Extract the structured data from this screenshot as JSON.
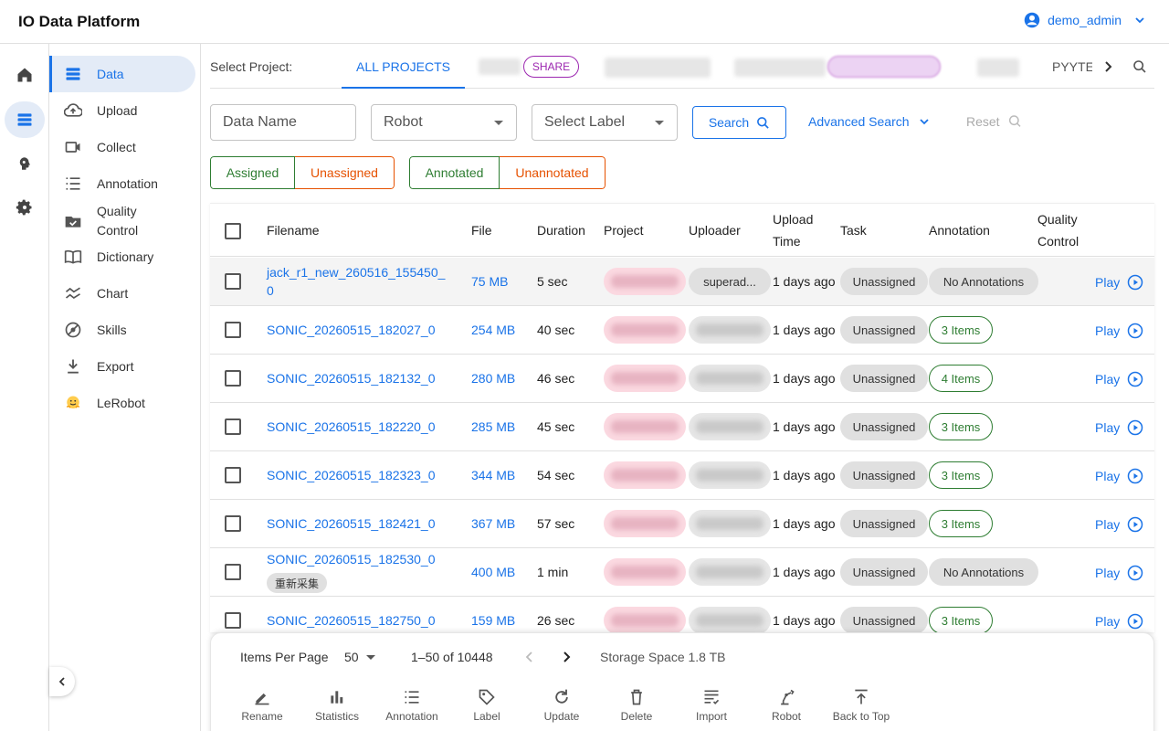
{
  "app": {
    "title": "IO Data Platform",
    "user": "demo_admin"
  },
  "rail": [
    {
      "name": "home-icon"
    },
    {
      "name": "data-icon"
    },
    {
      "name": "brain-icon"
    },
    {
      "name": "gear-icon"
    }
  ],
  "sidebar": {
    "items": [
      {
        "label": "Data",
        "icon": "list-icon"
      },
      {
        "label": "Upload",
        "icon": "cloud-upload-icon"
      },
      {
        "label": "Collect",
        "icon": "video-icon"
      },
      {
        "label": "Annotation",
        "icon": "checklist-icon"
      },
      {
        "label": "Quality Control",
        "icon": "folder-check-icon"
      },
      {
        "label": "Dictionary",
        "icon": "book-icon"
      },
      {
        "label": "Chart",
        "icon": "chart-icon"
      },
      {
        "label": "Skills",
        "icon": "skills-icon"
      },
      {
        "label": "Export",
        "icon": "download-icon"
      },
      {
        "label": "LeRobot",
        "icon": "hugging-face-icon"
      }
    ]
  },
  "projects": {
    "label": "Select Project:",
    "all": "ALL PROJECTS",
    "share": "SHARE",
    "partial": "PYYTE"
  },
  "filters": {
    "data_name": "Data Name",
    "robot": "Robot",
    "label": "Select Label",
    "search": "Search",
    "advanced": "Advanced Search",
    "reset": "Reset",
    "assigned": "Assigned",
    "unassigned": "Unassigned",
    "annotated": "Annotated",
    "unannotated": "Unannotated"
  },
  "table": {
    "headers": {
      "filename": "Filename",
      "file": "File",
      "duration": "Duration",
      "project": "Project",
      "uploader": "Uploader",
      "upload_time_1": "Upload",
      "upload_time_2": "Time",
      "task": "Task",
      "annotation": "Annotation",
      "qc_1": "Quality",
      "qc_2": "Control"
    },
    "rows": [
      {
        "name1": "jack_r1_new_260516_155450_",
        "name2": "0",
        "size": "75 MB",
        "duration": "5 sec",
        "uploader": "superad...",
        "time": "1 days ago",
        "task": "Unassigned",
        "annotation": "No Annotations",
        "play": "Play",
        "tag": ""
      },
      {
        "name1": "SONIC_20260515_182027_0",
        "name2": "",
        "size": "254 MB",
        "duration": "40 sec",
        "uploader": "",
        "time": "1 days ago",
        "task": "Unassigned",
        "annotation": "3 Items",
        "play": "Play",
        "tag": ""
      },
      {
        "name1": "SONIC_20260515_182132_0",
        "name2": "",
        "size": "280 MB",
        "duration": "46 sec",
        "uploader": "",
        "time": "1 days ago",
        "task": "Unassigned",
        "annotation": "4 Items",
        "play": "Play",
        "tag": ""
      },
      {
        "name1": "SONIC_20260515_182220_0",
        "name2": "",
        "size": "285 MB",
        "duration": "45 sec",
        "uploader": "",
        "time": "1 days ago",
        "task": "Unassigned",
        "annotation": "3 Items",
        "play": "Play",
        "tag": ""
      },
      {
        "name1": "SONIC_20260515_182323_0",
        "name2": "",
        "size": "344 MB",
        "duration": "54 sec",
        "uploader": "",
        "time": "1 days ago",
        "task": "Unassigned",
        "annotation": "3 Items",
        "play": "Play",
        "tag": ""
      },
      {
        "name1": "SONIC_20260515_182421_0",
        "name2": "",
        "size": "367 MB",
        "duration": "57 sec",
        "uploader": "",
        "time": "1 days ago",
        "task": "Unassigned",
        "annotation": "3 Items",
        "play": "Play",
        "tag": ""
      },
      {
        "name1": "SONIC_20260515_182530_0",
        "name2": "",
        "size": "400 MB",
        "duration": "1 min",
        "uploader": "",
        "time": "1 days ago",
        "task": "Unassigned",
        "annotation": "No Annotations",
        "play": "Play",
        "tag": "重新采集"
      },
      {
        "name1": "SONIC_20260515_182750_0",
        "name2": "",
        "size": "159 MB",
        "duration": "26 sec",
        "uploader": "",
        "time": "1 days ago",
        "task": "Unassigned",
        "annotation": "3 Items",
        "play": "Play",
        "tag": ""
      }
    ]
  },
  "pagination": {
    "items_per_page_label": "Items Per Page",
    "items_per_page": "50",
    "range": "1–50 of 10448",
    "storage": "Storage Space 1.8 TB"
  },
  "actions": [
    {
      "label": "Rename",
      "icon": "pencil-icon"
    },
    {
      "label": "Statistics",
      "icon": "bar-chart-icon"
    },
    {
      "label": "Annotation",
      "icon": "checklist-icon"
    },
    {
      "label": "Label",
      "icon": "tag-icon"
    },
    {
      "label": "Update",
      "icon": "refresh-icon"
    },
    {
      "label": "Delete",
      "icon": "trash-icon"
    },
    {
      "label": "Import",
      "icon": "import-icon"
    },
    {
      "label": "Robot",
      "icon": "robot-arm-icon"
    },
    {
      "label": "Back to Top",
      "icon": "arrow-top-icon"
    }
  ],
  "colors": {
    "accent": "#1a73e8",
    "green": "#2e7d32",
    "orange": "#e65100",
    "purple": "#9c27b0"
  }
}
